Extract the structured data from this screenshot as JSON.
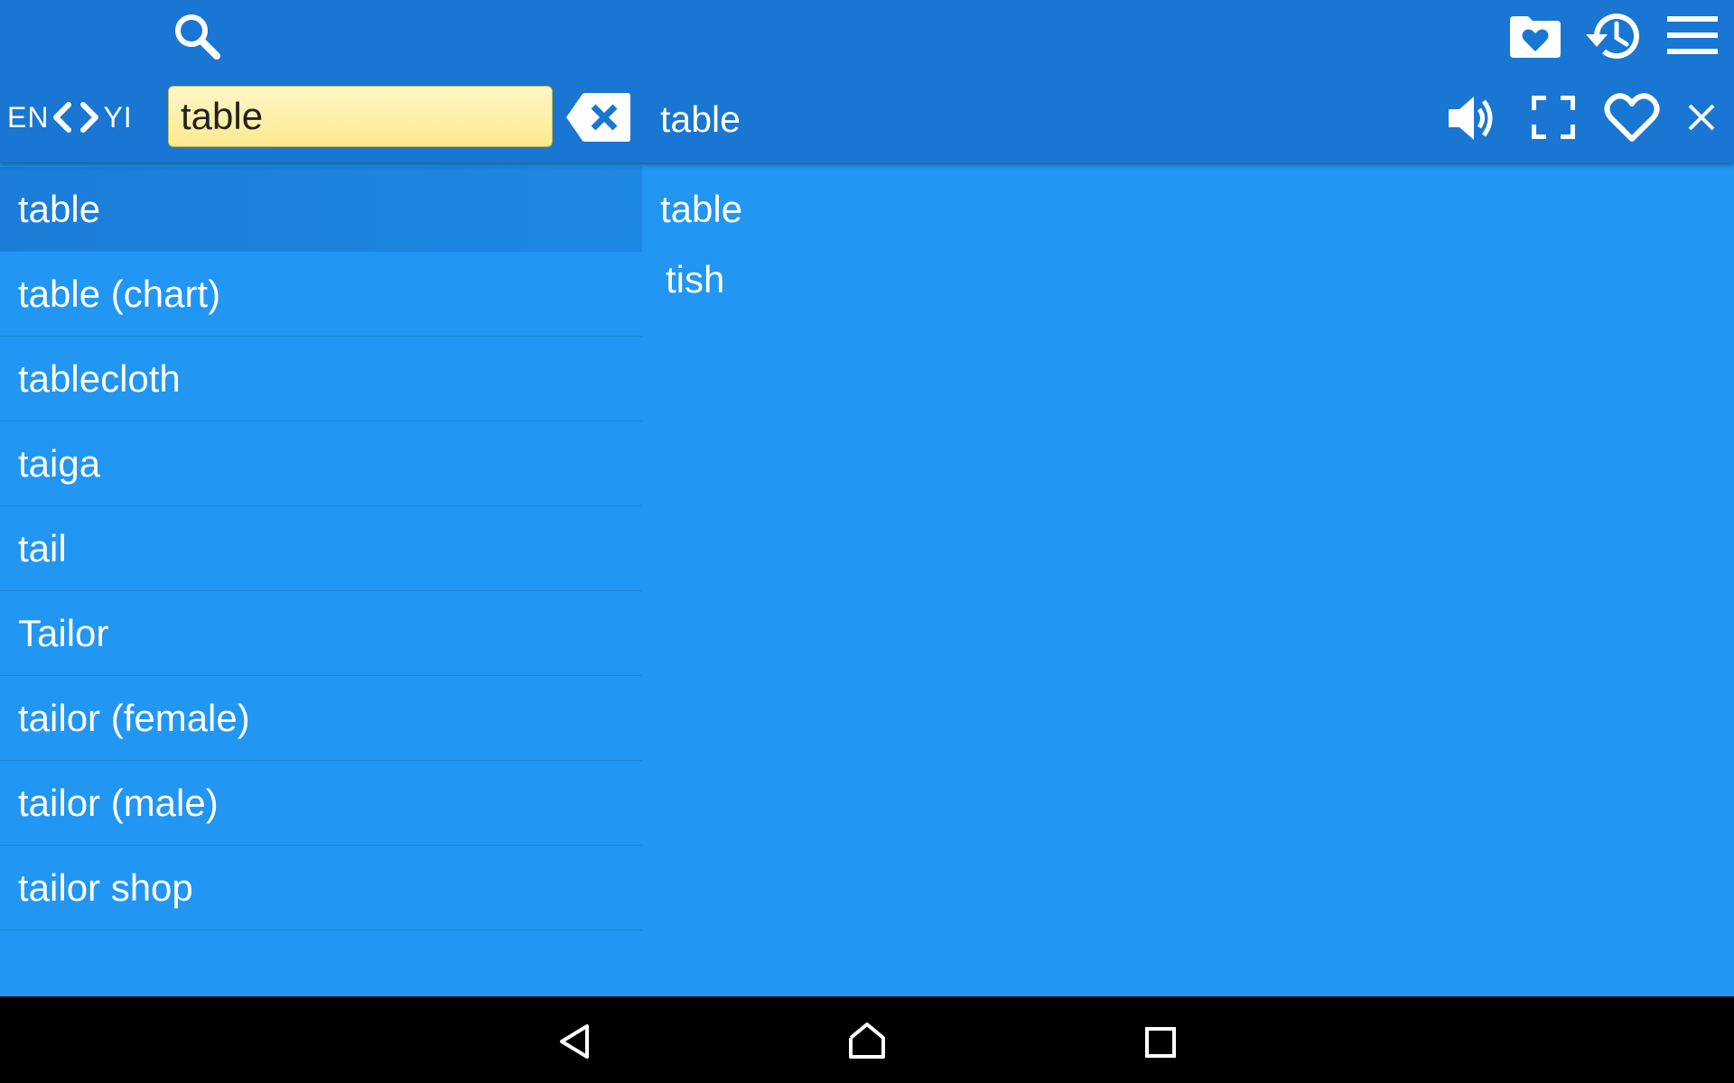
{
  "header": {
    "search_icon": "search-icon",
    "favorites_folder_icon": "folder-heart-icon",
    "history_icon": "history-icon",
    "menu_icon": "menu-icon"
  },
  "language": {
    "source": "EN",
    "target": "YI",
    "prev_icon": "chevron-left-icon",
    "next_icon": "chevron-right-icon"
  },
  "search": {
    "value": "table",
    "clear_icon": "backspace-clear-icon"
  },
  "detail_header": {
    "word": "table",
    "speaker_icon": "speaker-icon",
    "fullscreen_icon": "fullscreen-icon",
    "favorite_icon": "heart-icon",
    "close_icon": "close-icon"
  },
  "word_list": [
    "table",
    "table (chart)",
    "tablecloth",
    "taiga",
    "tail",
    "Tailor",
    "tailor (female)",
    "tailor (male)",
    "tailor shop"
  ],
  "entry": {
    "title": "table",
    "translation": "tish"
  },
  "navigation": {
    "back_icon": "back-icon",
    "home_icon": "home-icon",
    "recents_icon": "recents-icon"
  },
  "colors": {
    "app_bar": "#1976d2",
    "content_bg": "#2196f3",
    "search_field": "#fff3b0",
    "nav_bar": "#000000"
  }
}
